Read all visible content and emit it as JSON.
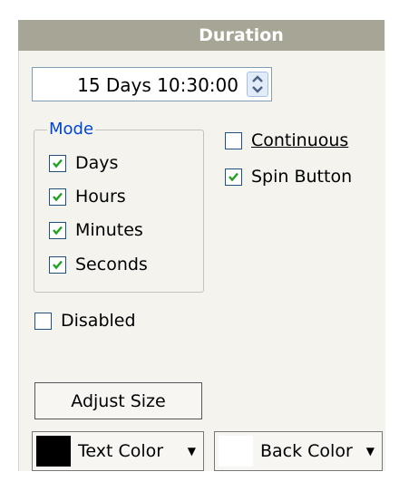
{
  "header": {
    "title": "Duration"
  },
  "duration": {
    "value": "15 Days 10:30:00"
  },
  "mode_group": {
    "legend": "Mode",
    "items": [
      {
        "label": "Days",
        "checked": true
      },
      {
        "label": "Hours",
        "checked": true
      },
      {
        "label": "Minutes",
        "checked": true
      },
      {
        "label": "Seconds",
        "checked": true
      }
    ]
  },
  "options": {
    "continuous": {
      "label": "Continuous",
      "checked": false
    },
    "spin_button": {
      "label": "Spin Button",
      "checked": true
    },
    "disabled": {
      "label": "Disabled",
      "checked": false
    }
  },
  "buttons": {
    "adjust_size": "Adjust Size",
    "text_color": {
      "label": "Text Color",
      "swatch": "#000000"
    },
    "back_color": {
      "label": "Back Color",
      "swatch": "#ffffff"
    }
  },
  "colors": {
    "header_bg": "#a7a595",
    "panel_bg": "#f4f3ee",
    "check_mark": "#21a121",
    "legend_text": "#0046d5"
  }
}
